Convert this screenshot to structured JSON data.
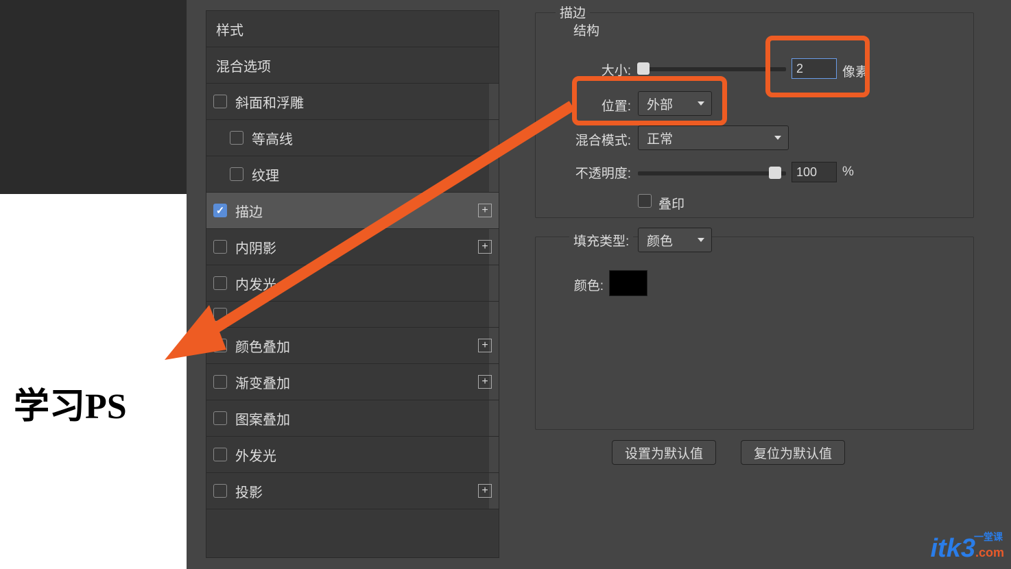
{
  "canvas": {
    "sample_text": "学习PS"
  },
  "styles_panel": {
    "header": "样式",
    "blend_options": "混合选项",
    "items": {
      "bevel_emboss": "斜面和浮雕",
      "contour": "等高线",
      "texture": "纹理",
      "stroke": "描边",
      "inner_shadow": "内阴影",
      "inner_glow": "内发光",
      "color_overlay": "颜色叠加",
      "gradient_overlay": "渐变叠加",
      "pattern_overlay": "图案叠加",
      "outer_glow": "外发光",
      "drop_shadow": "投影"
    }
  },
  "stroke_panel": {
    "title": "描边",
    "structure": "结构",
    "size_label": "大小:",
    "size_value": "2",
    "size_unit": "像素",
    "position_label": "位置:",
    "position_value": "外部",
    "blend_mode_label": "混合模式:",
    "blend_mode_value": "正常",
    "opacity_label": "不透明度:",
    "opacity_value": "100",
    "opacity_unit": "%",
    "overprint_label": "叠印",
    "fill_type_label": "填充类型:",
    "fill_type_value": "颜色",
    "color_label": "颜色:",
    "set_default": "设置为默认值",
    "reset_default": "复位为默认值"
  },
  "watermark": {
    "brand": "itk3",
    "tld": ".com",
    "cn": "一堂课"
  }
}
